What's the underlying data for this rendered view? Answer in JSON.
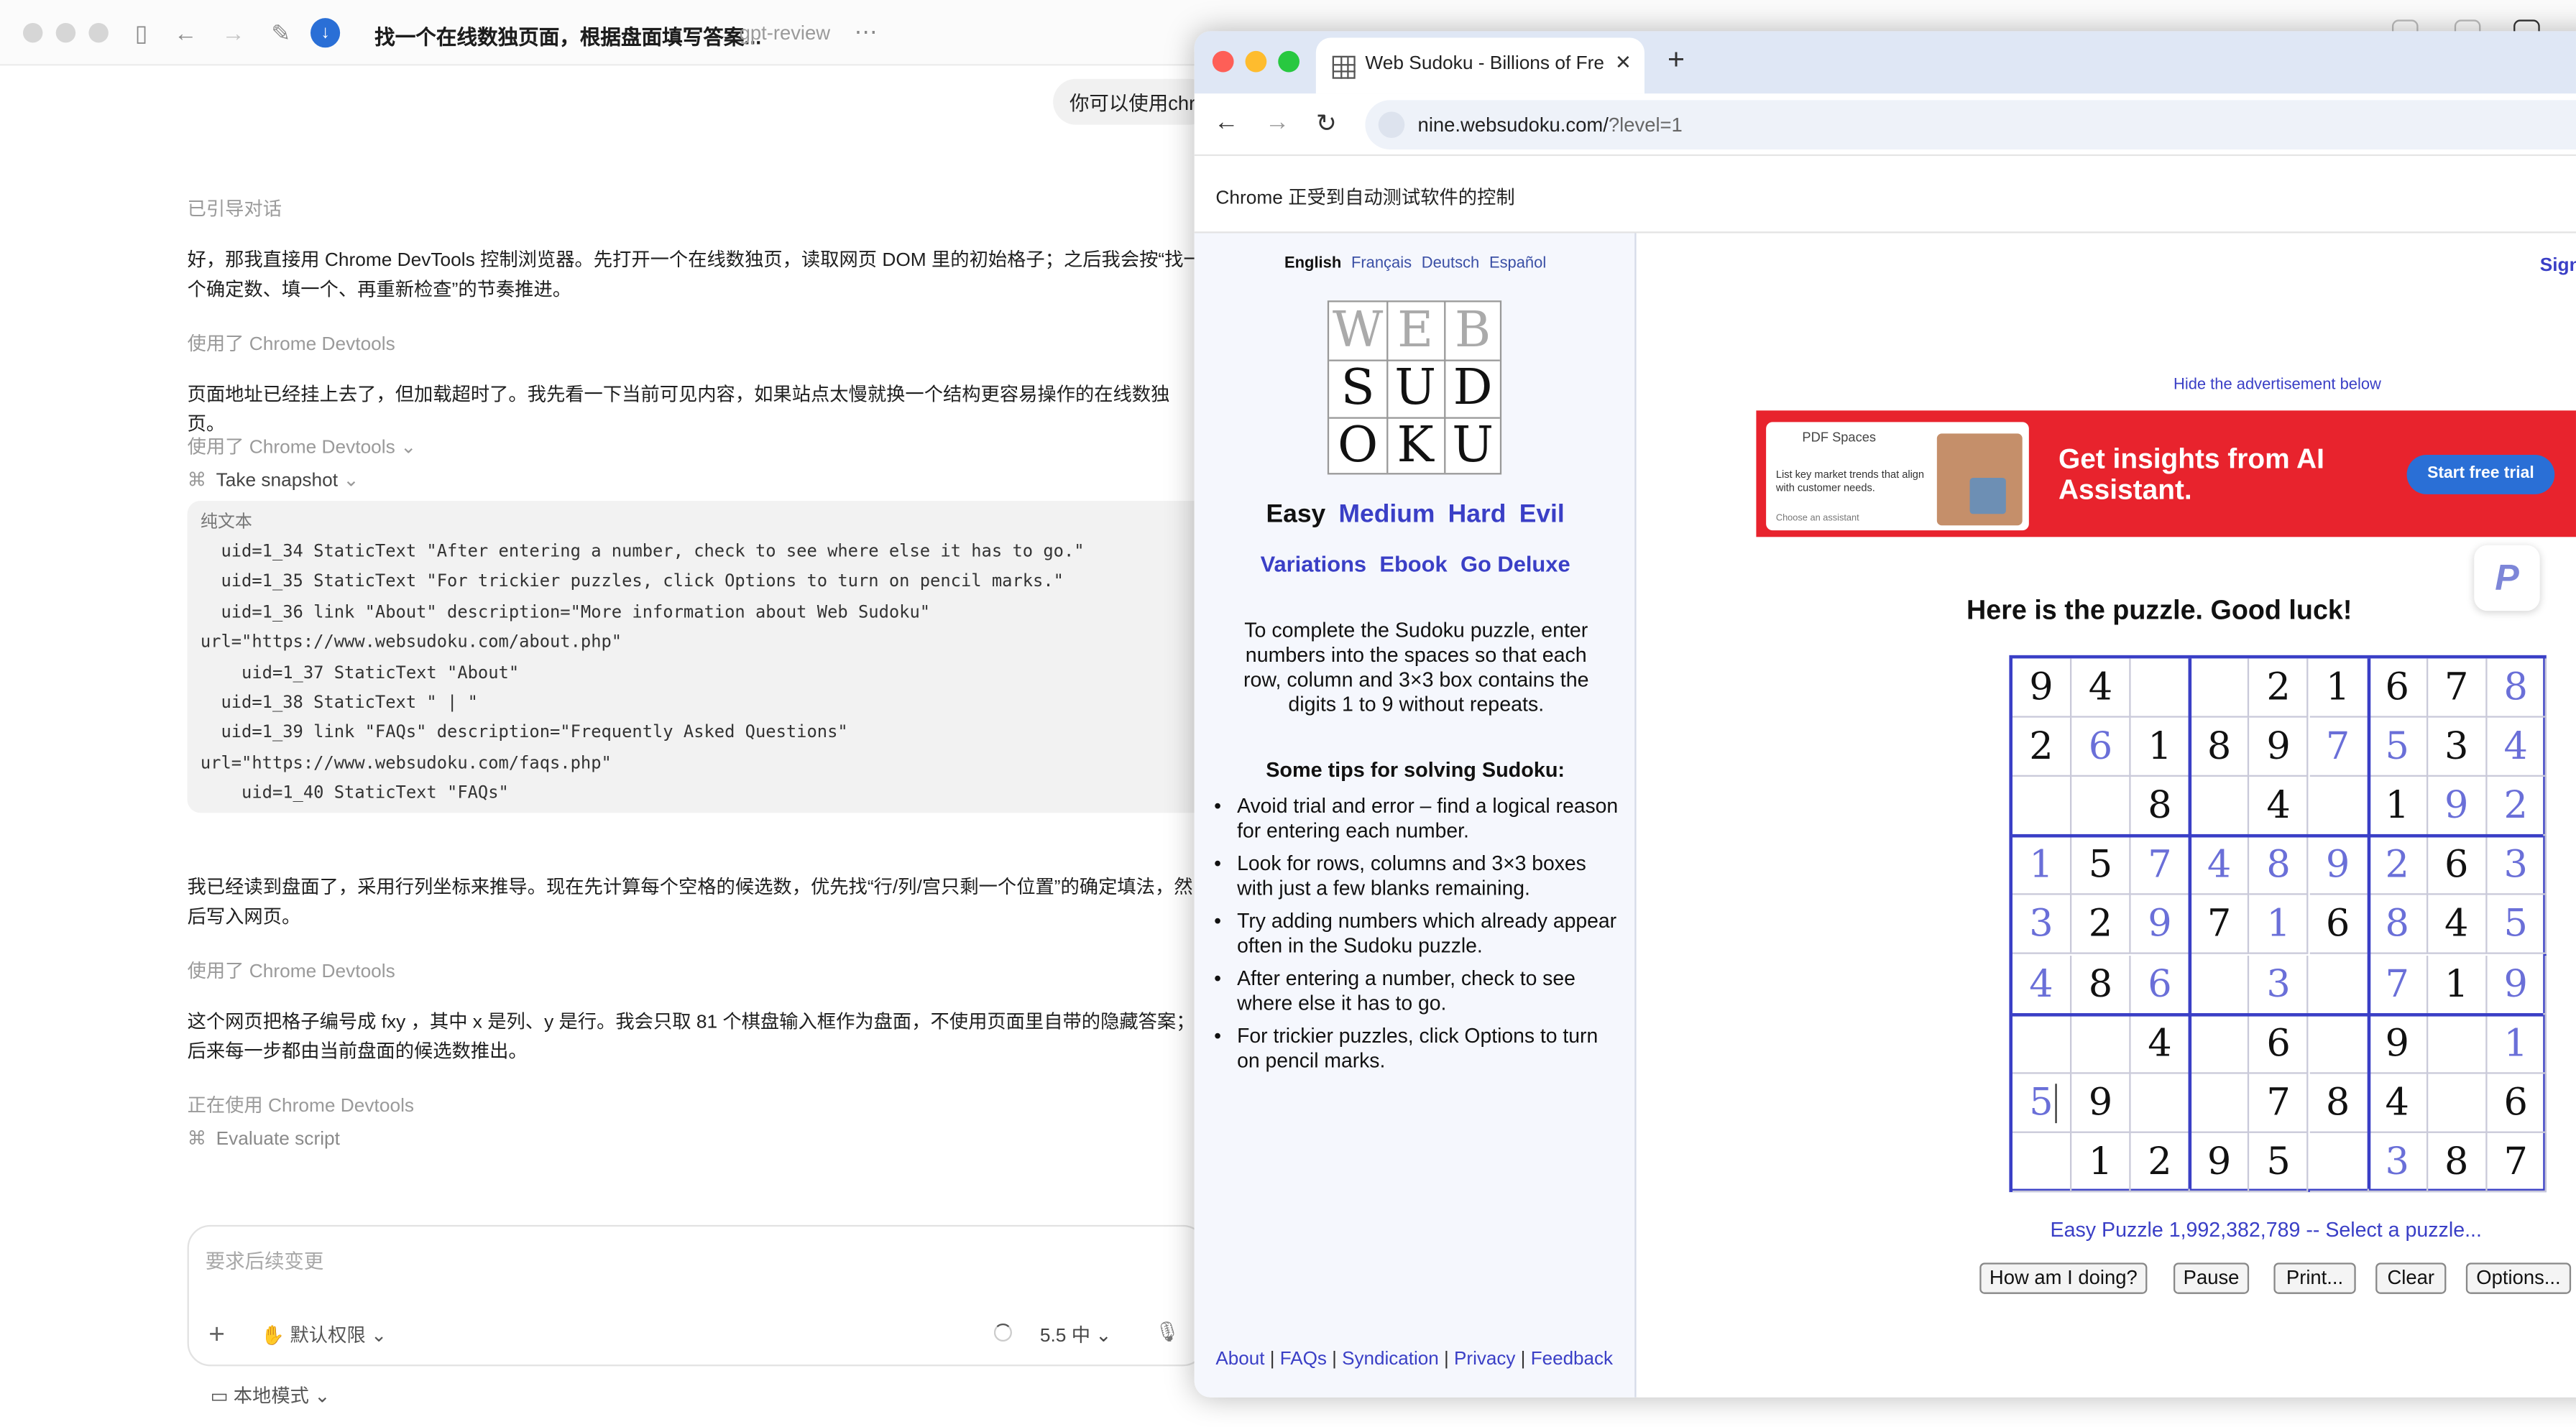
{
  "chat_app": {
    "title": "找一个在线数独页面，根据盘面填写答案...",
    "subtitle": "gpt-review",
    "user_message": "你可以使用chr",
    "messages": {
      "guided": "已引导对话",
      "p1": "好，那我直接用 Chrome DevTools 控制浏览器。先打开一个在线数独页，读取网页 DOM 里的初始格子；之后我会按“找一个确定数、填一个、再重新检查”的节奏推进。",
      "used1": "使用了 Chrome Devtools",
      "p2": "页面地址已经挂上去了，但加载超时了。我先看一下当前可见内容，如果站点太慢就换一个结构更容易操作的在线数独页。",
      "used2": "使用了 Chrome Devtools",
      "take_snapshot": "Take snapshot",
      "code_caption": "纯文本",
      "code_lines": [
        "  uid=1_34 StaticText \"After entering a number, check to see where else it has to go.\"",
        "  uid=1_35 StaticText \"For trickier puzzles, click Options to turn on pencil marks.\"",
        "  uid=1_36 link \"About\" description=\"More information about Web Sudoku\"",
        "url=\"https://www.websudoku.com/about.php\"",
        "    uid=1_37 StaticText \"About\"",
        "  uid=1_38 StaticText \" | \"",
        "  uid=1_39 link \"FAQs\" description=\"Frequently Asked Questions\"",
        "url=\"https://www.websudoku.com/faqs.php\"",
        "    uid=1_40 StaticText \"FAQs\""
      ],
      "p3": "我已经读到盘面了，采用行列坐标来推导。现在先计算每个空格的候选数，优先找“行/列/宫只剩一个位置”的确定填法，然后写入网页。",
      "used3": "使用了 Chrome Devtools",
      "p4": "这个网页把格子编号成  fxy ，其中 x 是列、y 是行。我会只取 81 个棋盘输入框作为盘面，不使用页面里自带的隐藏答案；后来每一步都由当前盘面的候选数推出。",
      "using": "正在使用 Chrome Devtools",
      "evaluate_script": "Evaluate script"
    },
    "composer": {
      "placeholder": "要求后续变更",
      "permission": "默认权限",
      "model": "5.5 中",
      "local_mode": "本地模式"
    }
  },
  "browser": {
    "tab_title": "Web Sudoku - Billions of Free",
    "url": "nine.websudoku.com/",
    "url_query": "?level=1",
    "automation_notice": "Chrome 正受到自动测试软件的控制"
  },
  "websudoku": {
    "languages": [
      "English",
      "Français",
      "Deutsch",
      "Español"
    ],
    "logo_letters": [
      "W",
      "E",
      "B",
      "S",
      "U",
      "D",
      "O",
      "K",
      "U"
    ],
    "levels": [
      "Easy",
      "Medium",
      "Hard",
      "Evil"
    ],
    "links": [
      "Variations",
      "Ebook",
      "Go Deluxe"
    ],
    "intro": "To complete the Sudoku puzzle, enter numbers into the spaces so that each row, column and 3×3 box contains the digits 1 to 9 without repeats.",
    "tips_title": "Some tips for solving Sudoku:",
    "tips": [
      "Avoid trial and error – find a logical reason for entering each number.",
      "Look for rows, columns and 3×3 boxes with just a few blanks remaining.",
      "Try adding numbers which already appear often in the Sudoku puzzle.",
      "After entering a number, check to see where else it has to go.",
      "For trickier puzzles, click Options to turn on pencil marks."
    ],
    "footer": [
      "About",
      "FAQs",
      "Syndication",
      "Privacy",
      "Feedback"
    ],
    "sign_in": "Sign",
    "hide_ad": "Hide the advertisement below",
    "ad": {
      "card_title": "PDF Spaces",
      "card_text": "List key market trends that align with customer needs.",
      "card_small": "Choose an assistant",
      "headline": "Get insights from AI Assistant.",
      "button": "Start free trial"
    },
    "badge": "P",
    "puzzle_heading": "Here is the puzzle. Good luck!",
    "puzzle_line": "Easy Puzzle 1,992,382,789 -- Select a puzzle...",
    "buttons": [
      "How am I doing?",
      "Pause",
      "Print...",
      "Clear",
      "Options..."
    ],
    "grid": [
      [
        "9",
        "4",
        "",
        "",
        "2",
        "1",
        "6",
        "7",
        "8"
      ],
      [
        "2",
        "6",
        "1",
        "8",
        "9",
        "7",
        "5",
        "3",
        "4"
      ],
      [
        "",
        "",
        "8",
        "",
        "4",
        "",
        "1",
        "9",
        "2"
      ],
      [
        "1",
        "5",
        "7",
        "4",
        "8",
        "9",
        "2",
        "6",
        "3"
      ],
      [
        "3",
        "2",
        "9",
        "7",
        "1",
        "6",
        "8",
        "4",
        "5"
      ],
      [
        "4",
        "8",
        "6",
        "",
        "3",
        "",
        "7",
        "1",
        "9"
      ],
      [
        "",
        "",
        "4",
        "",
        "6",
        "",
        "9",
        "",
        "1"
      ],
      [
        "5",
        "9",
        "",
        "",
        "7",
        "8",
        "4",
        "",
        "6"
      ],
      [
        "",
        "1",
        "2",
        "9",
        "5",
        "",
        "3",
        "8",
        "7"
      ]
    ],
    "user_entered": [
      [
        0,
        0,
        0,
        0,
        0,
        0,
        0,
        0,
        1
      ],
      [
        0,
        1,
        0,
        0,
        0,
        1,
        1,
        0,
        1
      ],
      [
        0,
        0,
        0,
        0,
        0,
        0,
        0,
        1,
        1
      ],
      [
        1,
        0,
        1,
        1,
        1,
        1,
        1,
        0,
        1
      ],
      [
        1,
        0,
        1,
        0,
        1,
        0,
        1,
        0,
        1
      ],
      [
        1,
        0,
        1,
        0,
        1,
        0,
        1,
        0,
        1
      ],
      [
        0,
        0,
        0,
        0,
        0,
        0,
        0,
        0,
        1
      ],
      [
        1,
        0,
        0,
        0,
        0,
        0,
        0,
        0,
        0
      ],
      [
        0,
        0,
        0,
        0,
        0,
        0,
        1,
        0,
        0
      ]
    ],
    "colors": {
      "link": "#3a3fc6",
      "given": "#111111",
      "entered": "#6a6fd8",
      "ad_red": "#e8232d"
    }
  }
}
